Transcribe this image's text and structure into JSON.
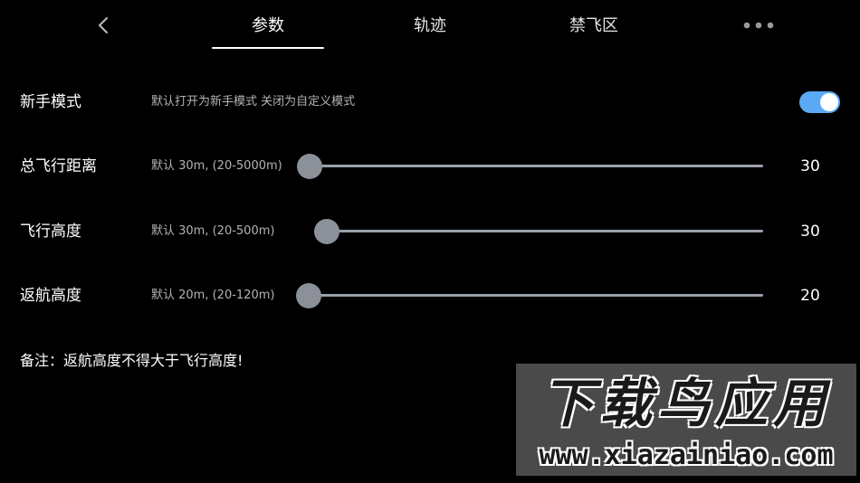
{
  "colors": {
    "background": "#000000",
    "accent": "#5aa9f5",
    "slider_thumb": "#8c9199",
    "slider_track": "#9aa0a8"
  },
  "header": {
    "back_icon": "chevron-left-icon",
    "tabs": [
      {
        "label": "参数",
        "active": true
      },
      {
        "label": "轨迹",
        "active": false
      },
      {
        "label": "禁飞区",
        "active": false
      }
    ],
    "more_icon": "more-horizontal-icon"
  },
  "settings": [
    {
      "id": "beginner_mode",
      "label": "新手模式",
      "description": "默认打开为新手模式 关闭为自定义模式",
      "type": "toggle",
      "enabled": true
    },
    {
      "id": "total_flight_distance",
      "label": "总飞行距离",
      "description": "默认 30m, (20-5000m)",
      "type": "slider",
      "min": 20,
      "max": 5000,
      "value": 30,
      "value_text": "30"
    },
    {
      "id": "flight_altitude",
      "label": "飞行高度",
      "description": "默认 30m, (20-500m)",
      "type": "slider",
      "min": 20,
      "max": 500,
      "value": 30,
      "value_text": "30"
    },
    {
      "id": "return_altitude",
      "label": "返航高度",
      "description": "默认 20m, (20-120m)",
      "type": "slider",
      "min": 20,
      "max": 120,
      "value": 20,
      "value_text": "20"
    }
  ],
  "note": "备注：返航高度不得大于飞行高度!",
  "watermark": {
    "title": "下载鸟应用",
    "url": "www.xiazainiao.com"
  }
}
